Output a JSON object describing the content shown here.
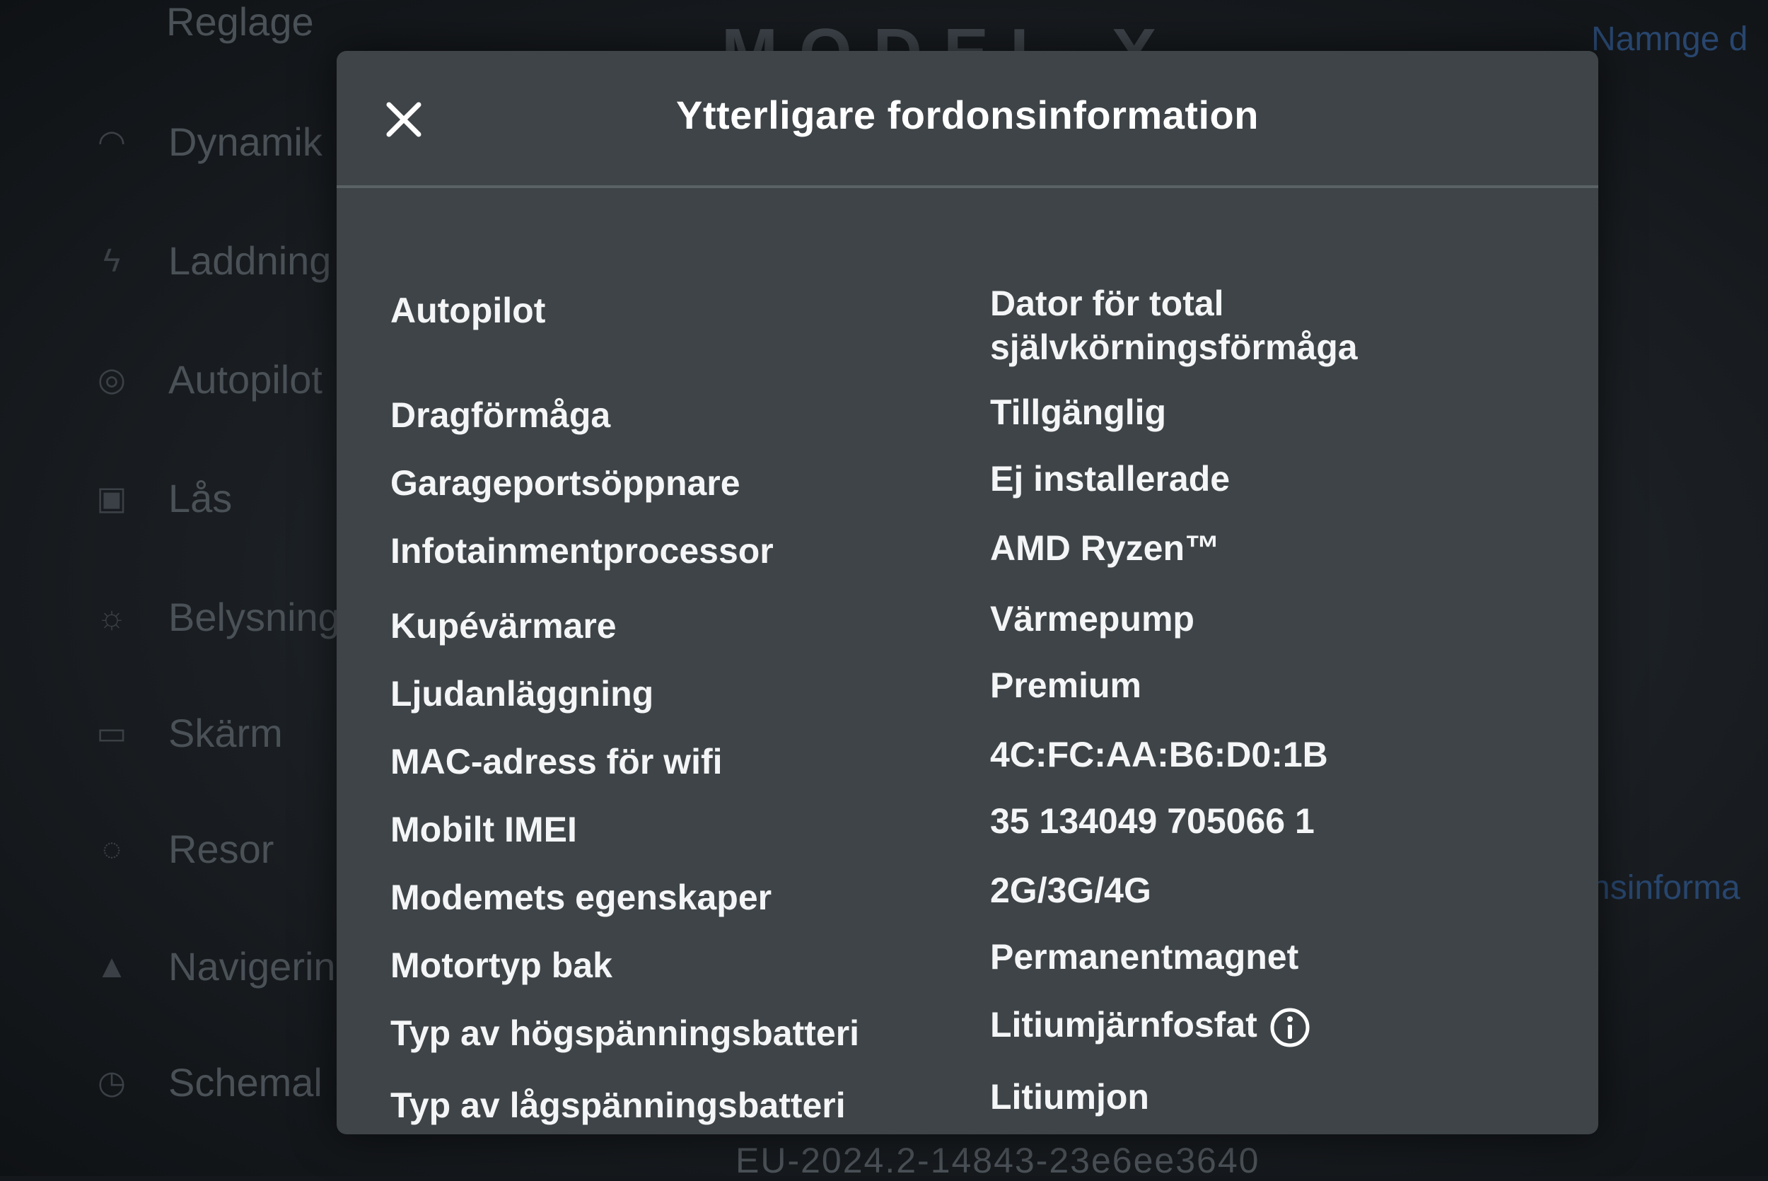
{
  "background": {
    "model_title": "MODEL X",
    "sidebar": {
      "items": [
        {
          "label": "Reglage",
          "icon": "car-icon"
        },
        {
          "label": "Dynamik",
          "icon": "steering-icon"
        },
        {
          "label": "Laddning",
          "icon": "bolt-icon"
        },
        {
          "label": "Autopilot",
          "icon": "steering-wheel-icon"
        },
        {
          "label": "Lås",
          "icon": "lock-icon"
        },
        {
          "label": "Belysning",
          "icon": "sun-icon"
        },
        {
          "label": "Skärm",
          "icon": "display-icon"
        },
        {
          "label": "Resor",
          "icon": "trips-icon"
        },
        {
          "label": "Navigering",
          "icon": "navigation-icon"
        },
        {
          "label": "Schemal",
          "icon": "clock-icon"
        }
      ]
    },
    "right_links": [
      "Namnge d",
      "nsinforma"
    ],
    "firmware": "EU-2024.2-14843-23e6ee3640"
  },
  "modal": {
    "title": "Ytterligare fordonsinformation",
    "close_icon": "close-icon",
    "rows": [
      {
        "label": "Autopilot",
        "value": "Dator för total",
        "value2": "självkörningsförmåga"
      },
      {
        "label": "Dragförmåga",
        "value": "Tillgänglig"
      },
      {
        "label": "Garageportsöppnare",
        "value": "Ej installerade"
      },
      {
        "label": "Infotainmentprocessor",
        "value": "AMD Ryzen™"
      },
      {
        "label": "Kupévärmare",
        "value": "Värmepump"
      },
      {
        "label": "Ljudanläggning",
        "value": "Premium"
      },
      {
        "label": "MAC-adress för wifi",
        "value": "4C:FC:AA:B6:D0:1B"
      },
      {
        "label": "Mobilt IMEI",
        "value": "35 134049 705066 1"
      },
      {
        "label": "Modemets egenskaper",
        "value": "2G/3G/4G"
      },
      {
        "label": "Motortyp bak",
        "value": "Permanentmagnet"
      },
      {
        "label": "Typ av högspänningsbatteri",
        "value": "Litiumjärnfosfat",
        "icon": "info-icon"
      },
      {
        "label": "Typ av lågspänningsbatteri",
        "value": "Litiumjon"
      }
    ]
  }
}
